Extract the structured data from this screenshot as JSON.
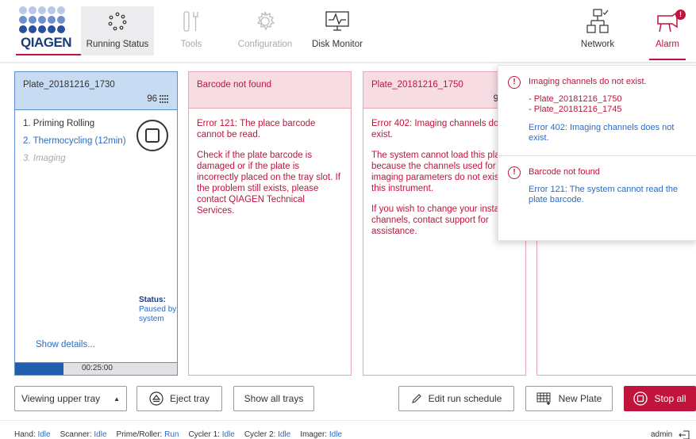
{
  "brand": {
    "logo_text": "QIAGEN",
    "accent": "#c0143c",
    "primary": "#1a3a7a"
  },
  "nav": {
    "running_status": "Running Status",
    "tools": "Tools",
    "configuration": "Configuration",
    "disk_monitor": "Disk Monitor",
    "network": "Network",
    "alarm": "Alarm",
    "alarm_badge": "!"
  },
  "run_panel": {
    "plate": "Plate_20181216_1730",
    "count": "96",
    "steps": [
      "1. Priming Rolling",
      "2. Thermocycling (12min)",
      "3. Imaging"
    ],
    "status_label": "Status:",
    "status_value": "Paused by system",
    "show_details": "Show details...",
    "time": "00:25:00",
    "progress": 0.3
  },
  "error_panel_1": {
    "title": "Barcode not found",
    "p1": "Error 121: The place barcode cannot be read.",
    "p2": "Check if the plate barcode is damaged or if the plate is incorrectly placed on the tray slot. If the problem still exists, please contact QIAGEN Technical Services."
  },
  "error_panel_2": {
    "title": "Plate_20181216_1750",
    "count": "9",
    "p1": "Error 402: Imaging channels do not exist.",
    "p2": "The system cannot load this plate because the channels used for its imaging parameters do not exist in this instrument.",
    "p3": "If you wish to change your installed channels, contact support for assistance."
  },
  "notifications": [
    {
      "title": "Imaging channels do not exist.",
      "plates": [
        "- Plate_20181216_1750",
        "- Plate_20181216_1745"
      ],
      "detail": "Error 402: Imaging channels does not exist."
    },
    {
      "title": "Barcode not found",
      "detail": "Error 121: The system cannot read the plate barcode."
    }
  ],
  "toolbar": {
    "tray_select": "Viewing upper tray",
    "eject": "Eject tray",
    "show_all": "Show all trays",
    "edit_schedule": "Edit run schedule",
    "new_plate": "New Plate",
    "stop_all": "Stop all"
  },
  "statusbar": {
    "hand_k": "Hand:",
    "hand_v": "Idle",
    "scanner_k": "Scanner:",
    "scanner_v": "Idle",
    "prime_k": "Prime/Roller:",
    "prime_v": "Run",
    "cycler1_k": "Cycler 1:",
    "cycler1_v": "Idle",
    "cycler2_k": "Cycler 2:",
    "cycler2_v": "Idle",
    "imager_k": "Imager:",
    "imager_v": "Idle",
    "user": "admin"
  }
}
